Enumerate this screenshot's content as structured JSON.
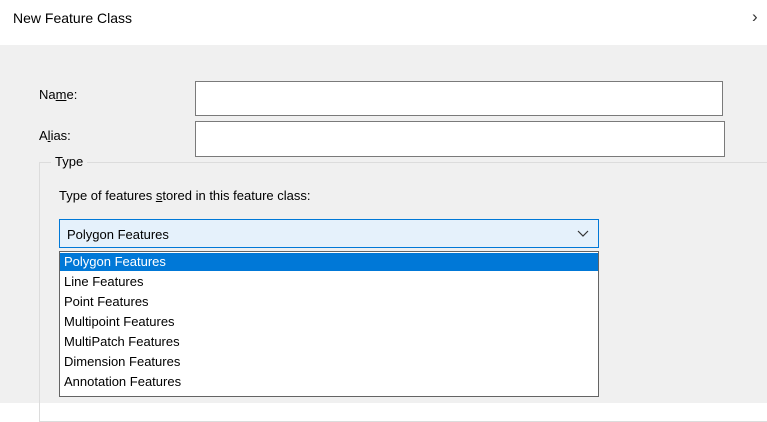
{
  "dialog": {
    "title": "New Feature Class",
    "close_glyph": "›"
  },
  "form": {
    "name_label_pre": "Na",
    "name_label_accel": "m",
    "name_label_post": "e:",
    "name_value": "",
    "alias_label_pre": "A",
    "alias_label_accel": "l",
    "alias_label_post": "ias:",
    "alias_value": ""
  },
  "type_group": {
    "legend": "Type",
    "prompt_pre": "Type of features ",
    "prompt_accel": "s",
    "prompt_post": "tored in this feature class:",
    "selected": "Polygon Features",
    "options": [
      "Polygon Features",
      "Line Features",
      "Point Features",
      "Multipoint Features",
      "MultiPatch Features",
      "Dimension Features",
      "Annotation Features"
    ],
    "highlighted_index": 0
  },
  "icons": {
    "close": "close-icon",
    "dropdown": "chevron-down-icon"
  },
  "colors": {
    "accent": "#0078d7",
    "dialog_bg": "#f0f0f0",
    "combo_bg": "#e5f1fb"
  }
}
